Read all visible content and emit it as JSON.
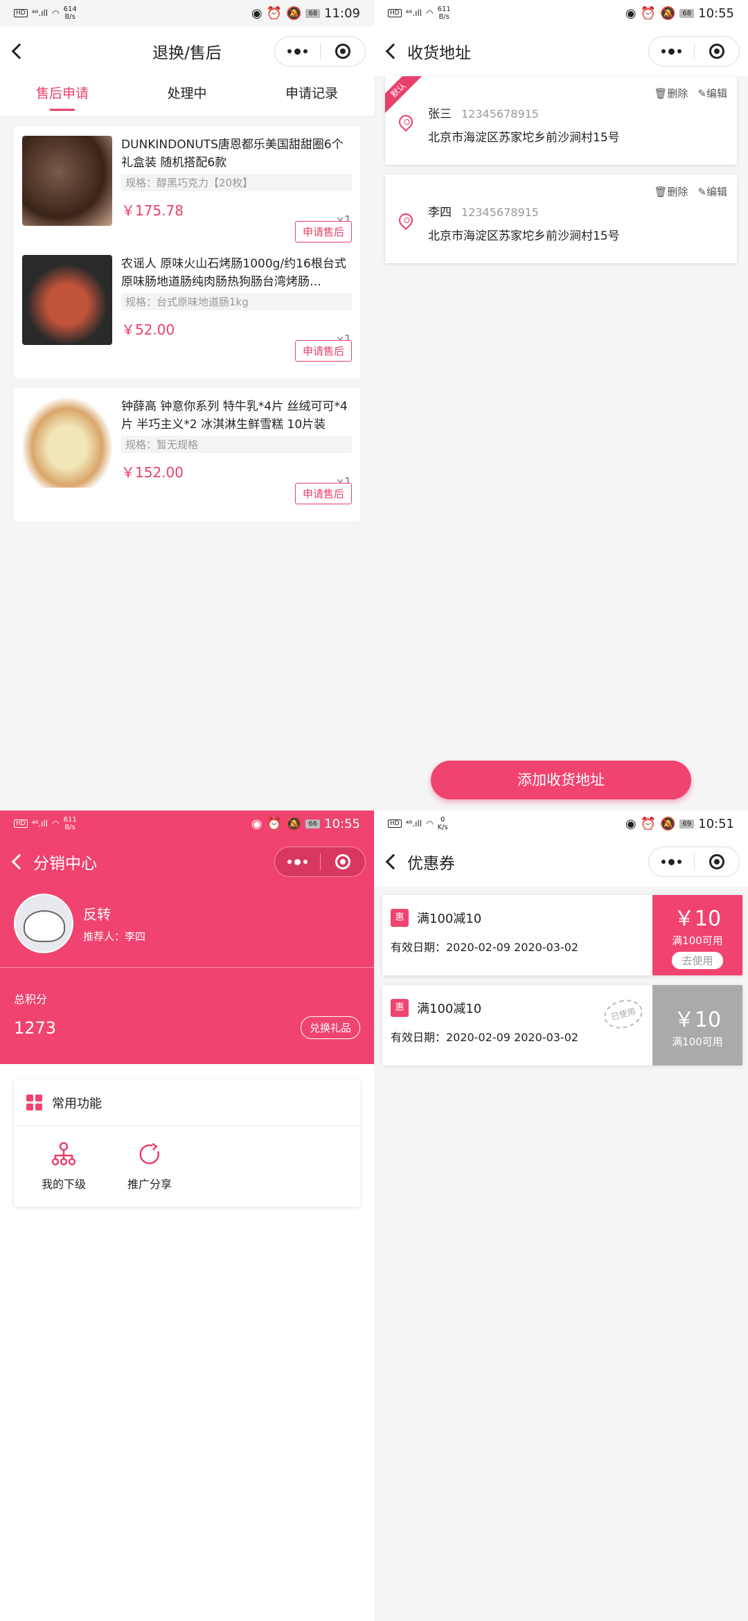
{
  "q1": {
    "status": {
      "hd": "HD",
      "net": "⁴⁶.ıll",
      "speed_top": "614",
      "speed_bot": "B/s",
      "battery": "68",
      "time": "11:09"
    },
    "nav_title": "退换/售后",
    "tabs": [
      "售后申请",
      "处理中",
      "申请记录"
    ],
    "products": [
      {
        "name": "DUNKINDONUTS唐恩都乐美国甜甜圈6个礼盒装 随机搭配6款",
        "spec": "规格：醇黑巧克力【20枚】",
        "price": "￥175.78",
        "qty": "x1",
        "btn": "申请售后"
      },
      {
        "name": "农谣人 原味火山石烤肠1000g/约16根台式原味肠地道肠纯肉肠热狗肠台湾烤肠…",
        "spec": "规格：台式原味地道肠1kg",
        "price": "￥52.00",
        "qty": "x1",
        "btn": "申请售后"
      },
      {
        "name": "钟薛高 钟意你系列 特牛乳*4片 丝绒可可*4片 半巧主义*2 冰淇淋生鲜雪糕 10片装",
        "spec": "规格：暂无规格",
        "price": "￥152.00",
        "qty": "x1",
        "btn": "申请售后"
      }
    ]
  },
  "q2": {
    "status": {
      "hd": "HD",
      "net": "⁴⁶.ıll",
      "speed_top": "611",
      "speed_bot": "B/s",
      "battery": "68",
      "time": "10:55"
    },
    "nav_title": "收货地址",
    "default_tag": "默认",
    "delete_label": "删除",
    "edit_label": "编辑",
    "addresses": [
      {
        "name": "张三",
        "phone": "12345678915",
        "address": "北京市海淀区苏家坨乡前沙涧村15号"
      },
      {
        "name": "李四",
        "phone": "12345678915",
        "address": "北京市海淀区苏家坨乡前沙涧村15号"
      }
    ],
    "add_button": "添加收货地址"
  },
  "q3": {
    "status": {
      "hd": "HD",
      "net": "⁴⁶.ıll",
      "speed_top": "611",
      "speed_bot": "B/s",
      "battery": "66",
      "time": "10:55"
    },
    "nav_title": "分销中心",
    "user_name": "反转",
    "referrer": "推荐人：李四",
    "points_label": "总积分",
    "points": "1273",
    "gift_button": "兑换礼品",
    "functions_title": "常用功能",
    "functions": [
      {
        "label": "我的下级"
      },
      {
        "label": "推广分享"
      }
    ],
    "colors": {
      "brand": "#f04370"
    }
  },
  "q4": {
    "status": {
      "hd": "HD",
      "net": "⁴⁶.ıll",
      "speed_top": "0",
      "speed_bot": "K/s",
      "battery": "69",
      "time": "10:51"
    },
    "nav_title": "优惠券",
    "coupons": [
      {
        "badge": "惠",
        "title": "满100减10",
        "date": "有效日期：2020-02-09 2020-03-02",
        "amount": "￥10",
        "cond": "满100可用",
        "action": "去使用"
      },
      {
        "badge": "惠",
        "title": "满100减10",
        "date": "有效日期：2020-02-09 2020-03-02",
        "amount": "￥10",
        "cond": "满100可用",
        "stamp": "已使用"
      }
    ]
  }
}
